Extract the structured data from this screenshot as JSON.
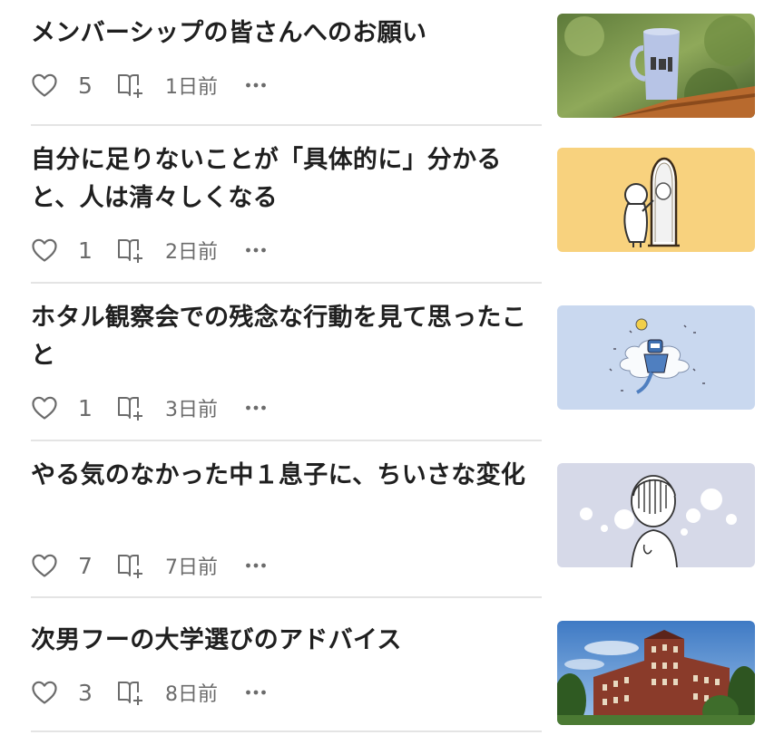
{
  "articles": [
    {
      "title": "メンバーシップの皆さんへのお願い",
      "likes": "5",
      "date": "1日前",
      "thumbnail_icon": "mug-photo"
    },
    {
      "title": "自分に足りないことが「具体的に」分かると、人は清々しくなる",
      "likes": "1",
      "date": "2日前",
      "thumbnail_icon": "mirror-illustration"
    },
    {
      "title": "ホタル観察会での残念な行動を見て思ったこと",
      "likes": "1",
      "date": "3日前",
      "thumbnail_icon": "cloud-robot-illustration"
    },
    {
      "title": "やる気のなかった中１息子に、ちいさな変化",
      "likes": "7",
      "date": "7日前",
      "thumbnail_icon": "boy-bubbles-illustration"
    },
    {
      "title": "次男フーの大学選びのアドバイス",
      "likes": "3",
      "date": "8日前",
      "thumbnail_icon": "university-building-photo"
    }
  ],
  "icons": {
    "like": "heart-outline-icon",
    "save": "book-add-icon",
    "more": "more-horizontal-icon"
  },
  "colors": {
    "text": "#1f1f1f",
    "meta": "#6b6b6b",
    "divider": "#e4e4e4",
    "thumb_mirror_bg": "#f8d27e",
    "thumb_cloud_bg": "#c9d8ef",
    "thumb_boy_bg": "#d6d9e8"
  }
}
